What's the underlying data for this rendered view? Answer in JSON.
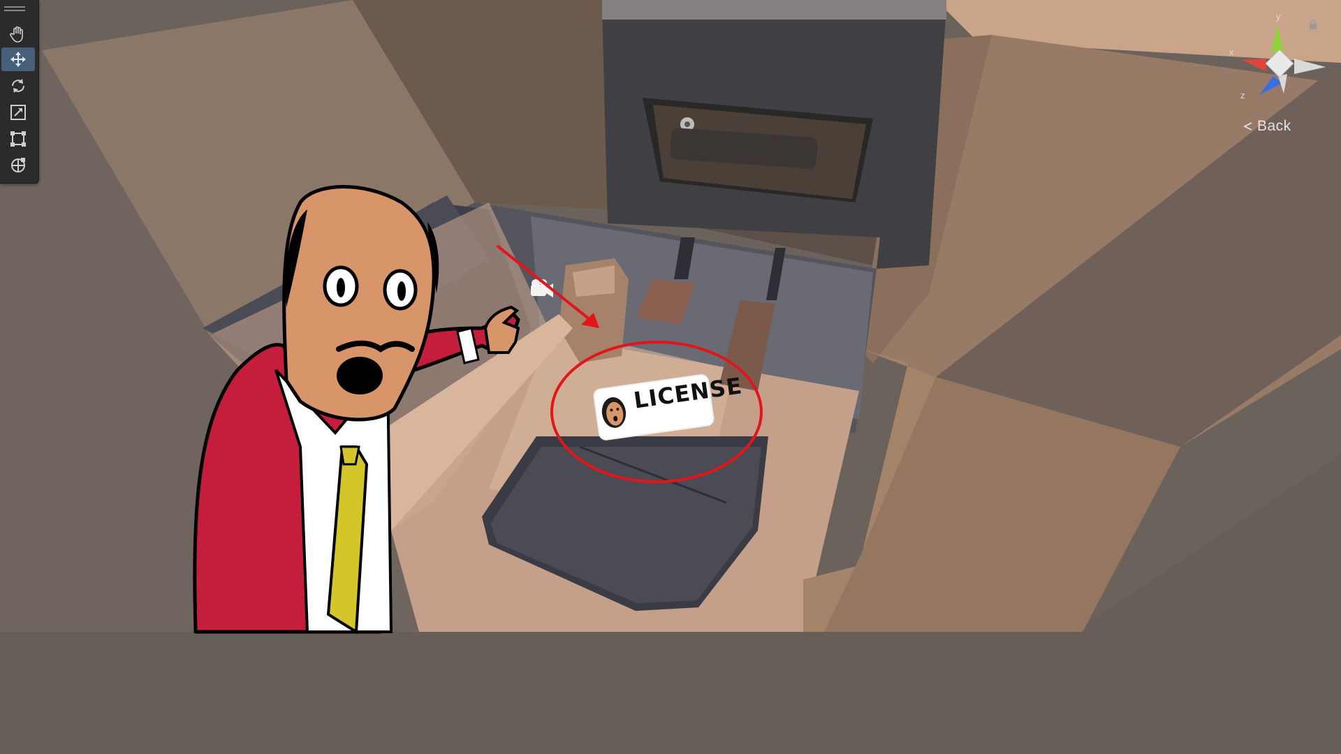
{
  "toolbar": {
    "tools": [
      {
        "name": "hand-tool",
        "icon": "hand-icon"
      },
      {
        "name": "move-tool",
        "icon": "move-icon",
        "active": true
      },
      {
        "name": "rotate-tool",
        "icon": "rotate-icon"
      },
      {
        "name": "scale-tool",
        "icon": "scale-icon"
      },
      {
        "name": "rect-tool",
        "icon": "rect-transform-icon"
      },
      {
        "name": "transform-tool",
        "icon": "transform-icon"
      }
    ]
  },
  "gizmo": {
    "axis_y": "y",
    "axis_x": "x",
    "axis_z": "z",
    "back_label": "Back",
    "colors": {
      "x": "#e0443a",
      "y": "#8ed13a",
      "z": "#3a6fe0"
    }
  },
  "badge": {
    "text": "LICENSE"
  },
  "colors": {
    "character_coat": "#c41e3c",
    "character_skin": "#d9956a",
    "tie": "#d4c62a",
    "annotation": "#e2161a",
    "active_tool": "#46607c"
  }
}
